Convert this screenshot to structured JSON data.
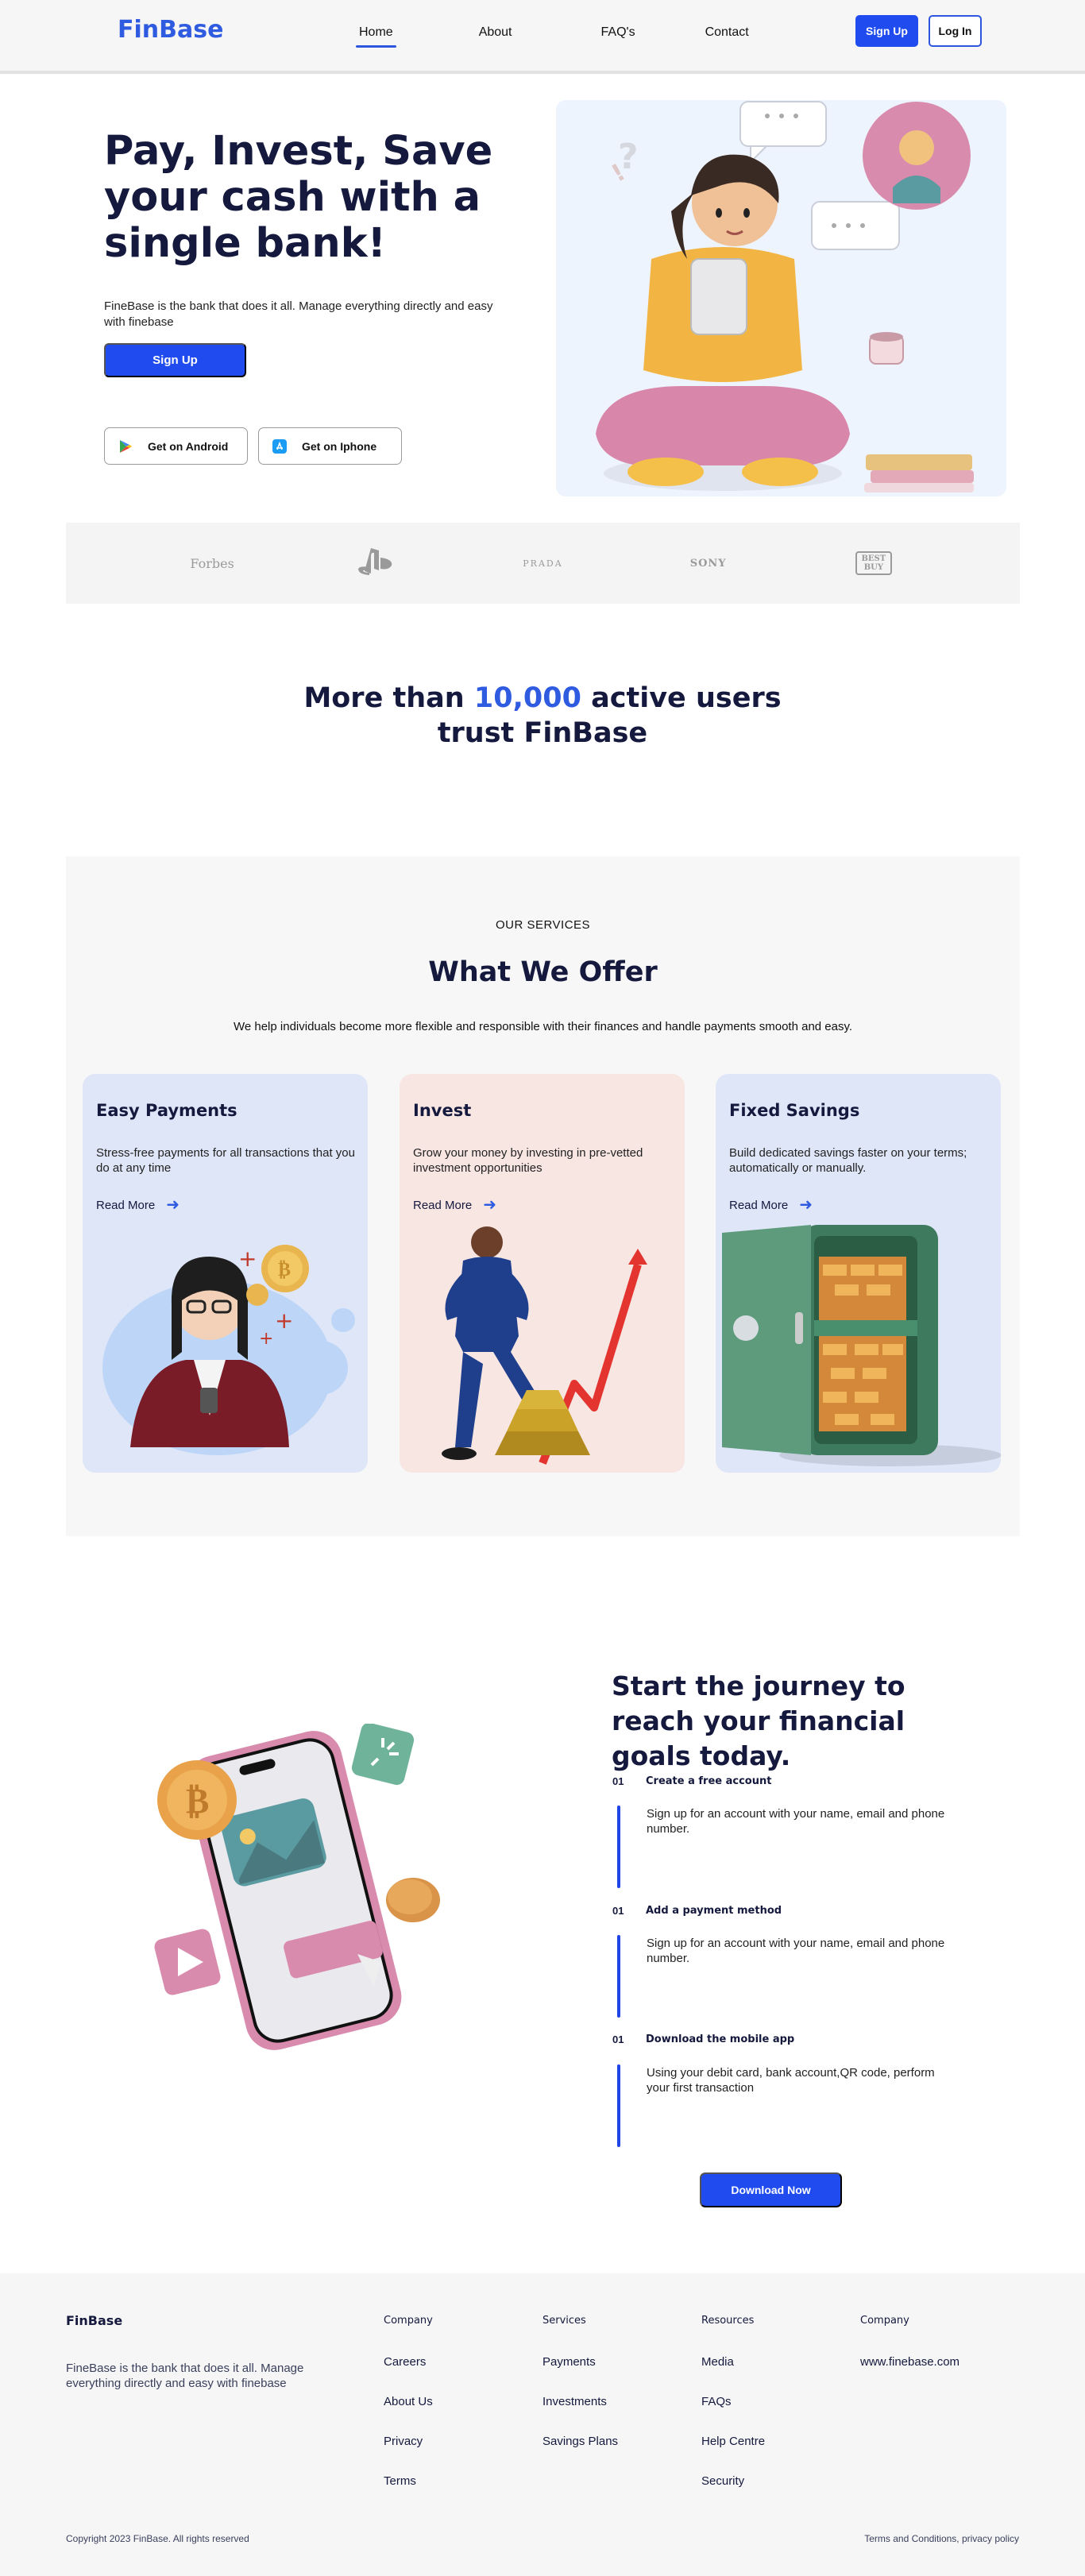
{
  "nav": {
    "logo": "FinBase",
    "links": [
      "Home",
      "About",
      "FAQ's",
      "Contact"
    ],
    "signup": "Sign Up",
    "login": "Log In"
  },
  "hero": {
    "title": "Pay, Invest, Save your cash with a single bank!",
    "description": "FineBase is the bank that does it all. Manage everything directly and easy with finebase",
    "signup": "Sign Up",
    "android": "Get on Android",
    "iphone": "Get on Iphone"
  },
  "brands": [
    "Forbes",
    "PlayStation",
    "PRADA",
    "SONY",
    "BEST BUY"
  ],
  "users": {
    "before": "More than ",
    "number": "10,000",
    "after": " active users",
    "line2": "trust FinBase"
  },
  "services": {
    "eyebrow": "OUR SERVICES",
    "title": "What We Offer",
    "description": "We help individuals become more flexible and responsible with their finances and handle payments smooth and easy.",
    "cards": [
      {
        "title": "Easy Payments",
        "text": "Stress-free payments for all transactions that you do at any time",
        "more": "Read More",
        "bg": "#dfe6f8"
      },
      {
        "title": "Invest",
        "text": "Grow your money by investing in pre-vetted investment opportunities",
        "more": "Read More",
        "bg": "#f8e6e3"
      },
      {
        "title": "Fixed Savings",
        "text": "Build dedicated savings faster on your terms; automatically or manually.",
        "more": "Read More",
        "bg": "#dfe6f8"
      }
    ]
  },
  "journey": {
    "title": "Start the journey to reach your financial goals today.",
    "steps": [
      {
        "no": "01",
        "title": "Create a free account",
        "text": "Sign up for an account with your name, email and phone number."
      },
      {
        "no": "01",
        "title": "Add a payment method",
        "text": "Sign up for an account with your name, email and phone number."
      },
      {
        "no": "01",
        "title": "Download the mobile app",
        "text": "Using your debit card, bank account,QR code, perform your first transaction"
      }
    ],
    "download": "Download Now"
  },
  "footer": {
    "brand": "FinBase",
    "description": "FineBase is the bank that does it all. Manage everything directly and easy with finebase",
    "columns": [
      {
        "title": "Company",
        "links": [
          "Careers",
          "About Us",
          "Privacy",
          "Terms"
        ]
      },
      {
        "title": "Services",
        "links": [
          "Payments",
          "Investments",
          "Savings Plans"
        ]
      },
      {
        "title": "Resources",
        "links": [
          "Media",
          "FAQs",
          "Help Centre",
          "Security"
        ]
      },
      {
        "title": "Company",
        "links": [
          "www.finebase.com"
        ]
      }
    ],
    "copyright": "Copyright 2023 FinBase. All rights reserved",
    "terms": "Terms and Conditions, privacy policy"
  },
  "colors": {
    "accent": "#1f4bef",
    "heading": "#14193d",
    "card_blue": "#dfe6f8",
    "card_pink": "#f8e6e3"
  }
}
